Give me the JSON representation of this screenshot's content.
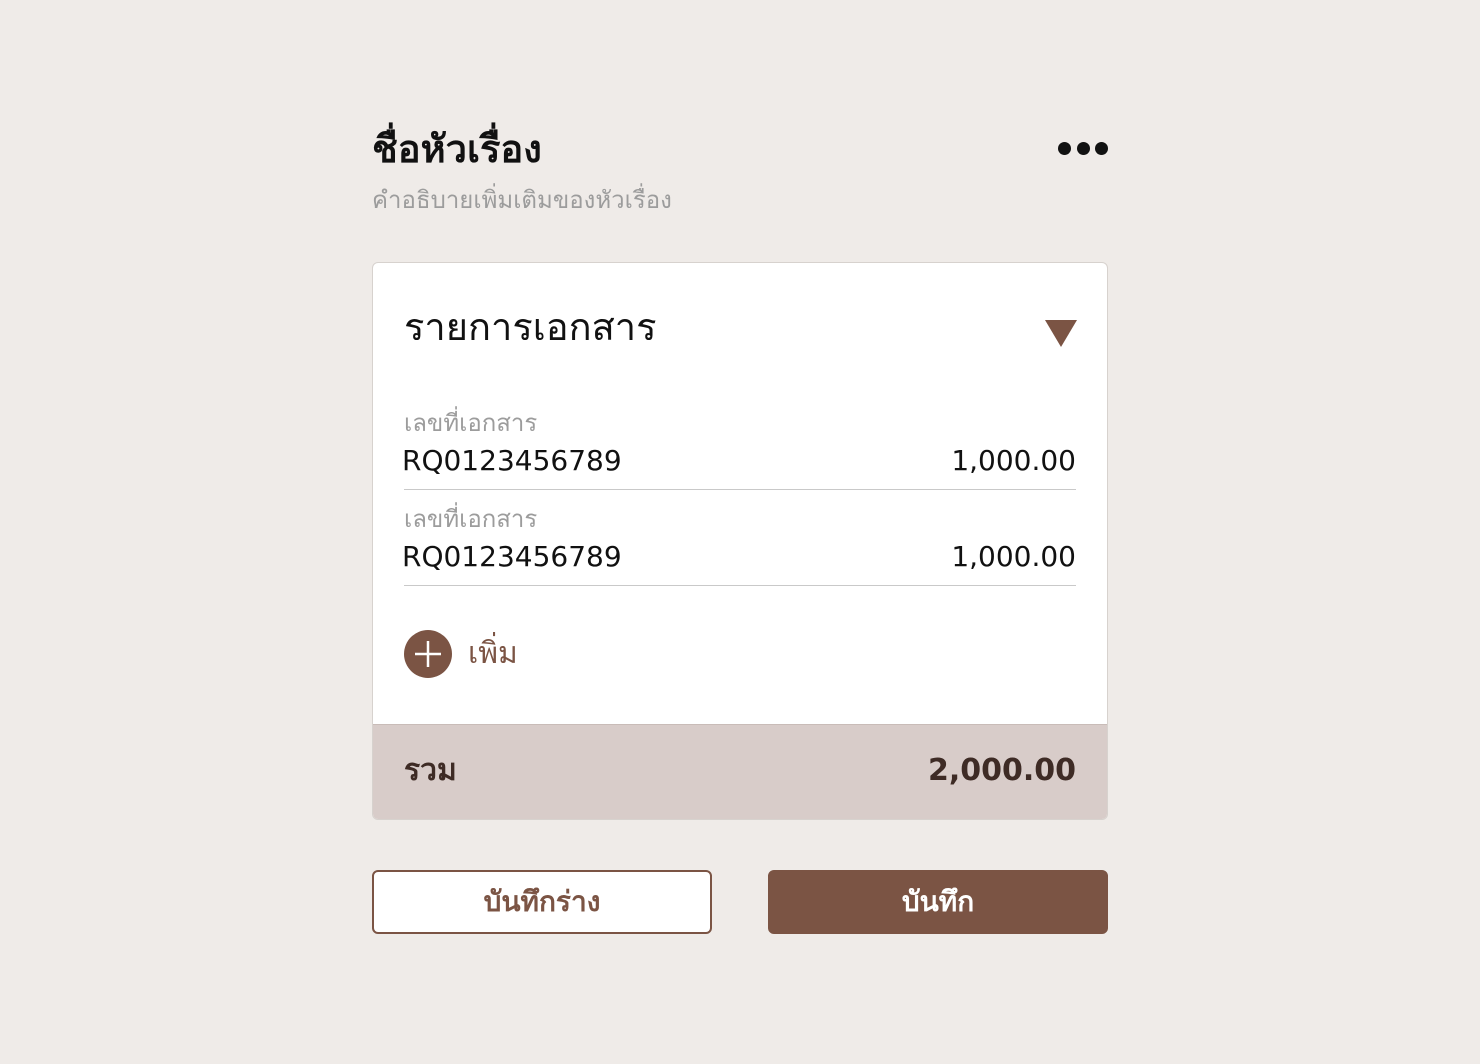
{
  "header": {
    "title": "ชื่อหัวเรื่อง",
    "subtitle": "คำอธิบายเพิ่มเติมของหัวเรื่อง",
    "more_icon": "more-horizontal-icon"
  },
  "card": {
    "title": "รายการเอกสาร",
    "toggle_icon": "triangle-down-icon",
    "items": [
      {
        "label": "เลขที่เอกสาร",
        "number": "RQ0123456789",
        "amount": "1,000.00"
      },
      {
        "label": "เลขที่เอกสาร",
        "number": "RQ0123456789",
        "amount": "1,000.00"
      }
    ],
    "add_label": "เพิ่ม",
    "add_icon": "plus-circle-icon",
    "total_label": "รวม",
    "total_amount": "2,000.00"
  },
  "actions": {
    "draft_label": "บันทึกร่าง",
    "save_label": "บันทึก"
  },
  "colors": {
    "accent": "#7b5444",
    "background": "#efebe8",
    "total_bar": "#d8ccc9"
  }
}
